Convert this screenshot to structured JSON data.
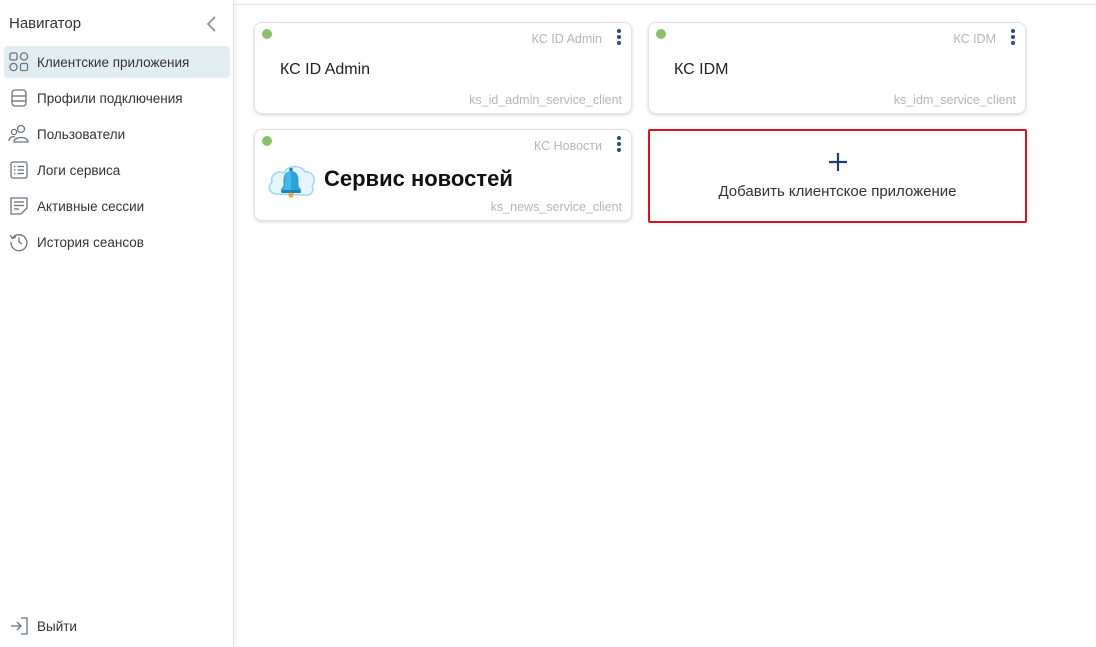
{
  "sidebar": {
    "title": "Навигатор",
    "items": [
      {
        "label": "Клиентские приложения",
        "icon": "apps-grid-icon",
        "active": true
      },
      {
        "label": "Профили подключения",
        "icon": "database-icon",
        "active": false
      },
      {
        "label": "Пользователи",
        "icon": "users-icon",
        "active": false
      },
      {
        "label": "Логи сервиса",
        "icon": "list-icon",
        "active": false
      },
      {
        "label": "Активные сессии",
        "icon": "sessions-icon",
        "active": false
      },
      {
        "label": "История сеансов",
        "icon": "history-icon",
        "active": false
      }
    ],
    "logout_label": "Выйти"
  },
  "cards": [
    {
      "tag": "КС ID Admin",
      "name": "КС ID Admin",
      "client": "ks_id_admin_service_client",
      "status": "active"
    },
    {
      "tag": "КС IDM",
      "name": "КС IDM",
      "client": "ks_idm_service_client",
      "status": "active"
    },
    {
      "tag": "КС Новости",
      "name": "Сервис новостей",
      "client": "ks_news_service_client",
      "status": "active",
      "logo": "cloud-bell-logo"
    }
  ],
  "add_card": {
    "plus": "+",
    "label": "Добавить клиентское приложение"
  },
  "colors": {
    "active_nav_bg": "#e2edf2",
    "status_green": "#8ac06a",
    "menu_dots": "#2a4d7c",
    "highlight_border": "#d9121b"
  }
}
